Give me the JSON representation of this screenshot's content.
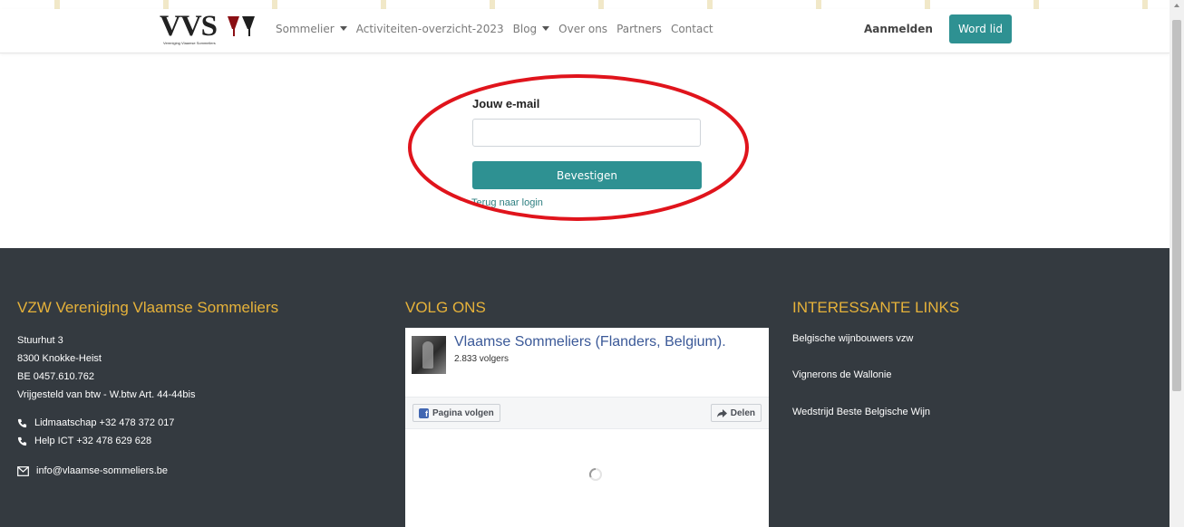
{
  "colors": {
    "accent": "#2e9192",
    "footer_bg": "#343a40",
    "footer_heading": "#e6b23a",
    "annotation": "#e0141c",
    "facebook_blue": "#3b5998"
  },
  "navbar": {
    "logo": {
      "text": "VVS",
      "subtitle": "Vereniging Vlaamse Sommeliers"
    },
    "links": [
      {
        "label": "Sommelier",
        "has_dropdown": true
      },
      {
        "label": "Activiteiten-overzicht-2023",
        "has_dropdown": false
      },
      {
        "label": "Blog",
        "has_dropdown": true
      },
      {
        "label": "Over ons",
        "has_dropdown": false
      },
      {
        "label": "Partners",
        "has_dropdown": false
      },
      {
        "label": "Contact",
        "has_dropdown": false
      }
    ],
    "login_label": "Aanmelden",
    "join_label": "Word lid"
  },
  "form": {
    "email_label": "Jouw e-mail",
    "email_value": "",
    "email_placeholder": "",
    "submit_label": "Bevestigen",
    "back_link": "Terug naar login"
  },
  "footer": {
    "about": {
      "title": "VZW Vereniging Vlaamse Sommeliers",
      "address_lines": [
        "Stuurhut 3",
        "8300 Knokke-Heist",
        "BE 0457.610.762",
        "Vrijgesteld van btw - W.btw Art. 44-44bis"
      ],
      "phones": [
        "Lidmaatschap +32 478 372 017",
        "Help ICT +32 478 629 628"
      ],
      "email": "info@vlaamse-sommeliers.be"
    },
    "social": {
      "title": "VOLG ONS",
      "page_name": "Vlaamse Sommeliers (Flanders, Belgium).",
      "followers": "2.833 volgers",
      "follow_label": "Pagina volgen",
      "share_label": "Delen"
    },
    "links": {
      "title": "INTERESSANTE LINKS",
      "items": [
        "Belgische wijnbouwers vzw",
        "Vignerons de Wallonie",
        "Wedstrijd Beste Belgische Wijn"
      ]
    }
  },
  "icons": [
    "phone-icon",
    "envelope-icon",
    "facebook-icon",
    "share-icon",
    "loading-spinner-icon",
    "caret-down-icon"
  ]
}
